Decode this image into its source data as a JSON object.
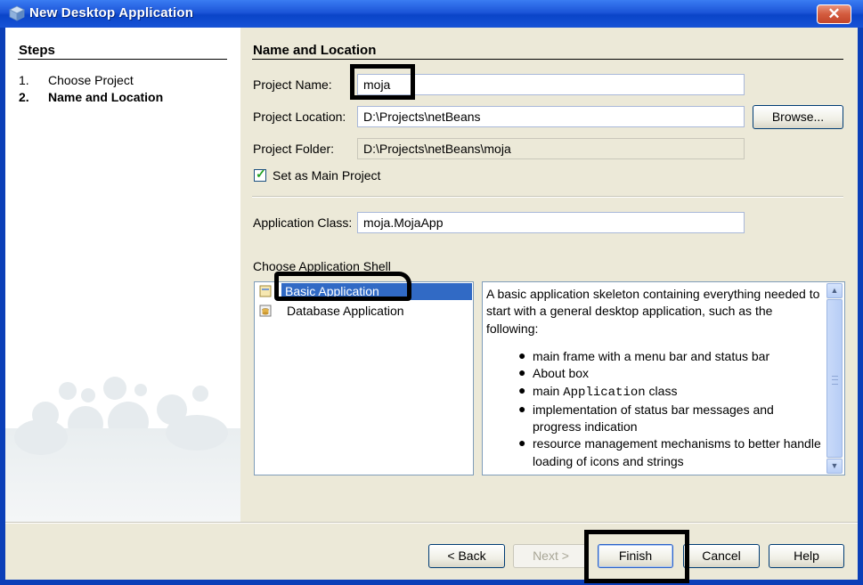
{
  "window": {
    "title": "New Desktop Application",
    "close_glyph": "✕"
  },
  "steps": {
    "title": "Steps",
    "items": [
      {
        "num": "1.",
        "label": "Choose Project"
      },
      {
        "num": "2.",
        "label": "Name and Location"
      }
    ]
  },
  "section": {
    "title": "Name and Location"
  },
  "fields": {
    "project_name": {
      "label": "Project Name:",
      "value": "moja"
    },
    "project_location": {
      "label": "Project Location:",
      "value": "D:\\Projects\\netBeans"
    },
    "project_folder": {
      "label": "Project Folder:",
      "value": "D:\\Projects\\netBeans\\moja"
    },
    "application_class": {
      "label": "Application Class:",
      "value": "moja.MojaApp"
    }
  },
  "browse_button": "Browse...",
  "set_main_project": {
    "label": "Set as Main Project",
    "checked": true
  },
  "shell": {
    "label": "Choose Application Shell",
    "items": [
      {
        "label": "Basic Application",
        "selected": true,
        "icon": "form-icon"
      },
      {
        "label": "Database Application",
        "selected": false,
        "icon": "database-form-icon"
      }
    ]
  },
  "description": {
    "intro": "A basic application skeleton containing everything needed to start with a general desktop application, such as the following:",
    "bullets": [
      {
        "pre": "main frame with a menu bar and status bar",
        "code": "",
        "post": ""
      },
      {
        "pre": "About box",
        "code": "",
        "post": ""
      },
      {
        "pre": "main ",
        "code": "Application",
        "post": " class"
      },
      {
        "pre": "implementation of status bar messages and progress indication",
        "code": "",
        "post": ""
      },
      {
        "pre": "resource management mechanisms to better handle loading of icons and strings",
        "code": "",
        "post": ""
      }
    ]
  },
  "buttons": {
    "back": "< Back",
    "next": "Next >",
    "finish": "Finish",
    "cancel": "Cancel",
    "help": "Help"
  },
  "colors": {
    "title_bar": "#0a44c8",
    "selection": "#316ac5",
    "dialog_bg": "#ece9d8",
    "annotation": "#000000"
  }
}
